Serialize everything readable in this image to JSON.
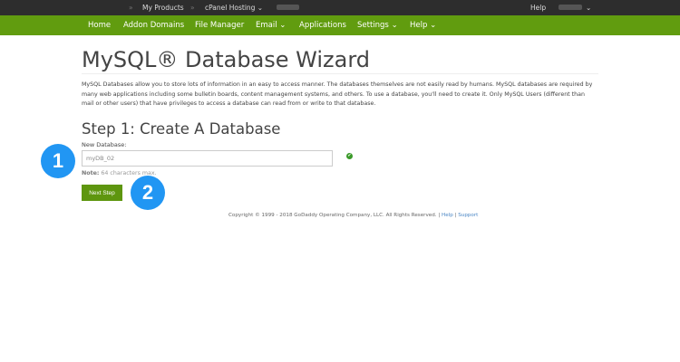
{
  "topbar": {
    "sep1": "»",
    "my_products": "My Products",
    "sep2": "»",
    "hosting": "cPanel Hosting ⌄",
    "help": "Help",
    "account_chevron": "⌄"
  },
  "nav": {
    "items": [
      "Home",
      "Addon Domains",
      "File Manager",
      "Email ⌄",
      "Applications",
      "Settings ⌄",
      "Help ⌄"
    ]
  },
  "page": {
    "title": "MySQL® Database Wizard",
    "description": "MySQL Databases allow you to store lots of information in an easy to access manner. The databases themselves are not easily read by humans. MySQL databases are required by many web applications including some bulletin boards, content management systems, and others. To use a database, you'll need to create it. Only MySQL Users (different than mail or other users) that have privileges to access a database can read from or write to that database.",
    "step_title": "Step 1: Create A Database",
    "field_label": "New Database:",
    "field_value": "myDB_02",
    "valid_icon": "✔",
    "note_label": "Note:",
    "note_text": "64 characters max.",
    "next_button": "Next Step"
  },
  "badges": [
    "1",
    "2"
  ],
  "footer": {
    "copyright": "Copyright © 1999 - 2018 GoDaddy Operating Company, LLC. All Rights Reserved.",
    "sep": "|",
    "help": "Help",
    "support": "Support"
  }
}
